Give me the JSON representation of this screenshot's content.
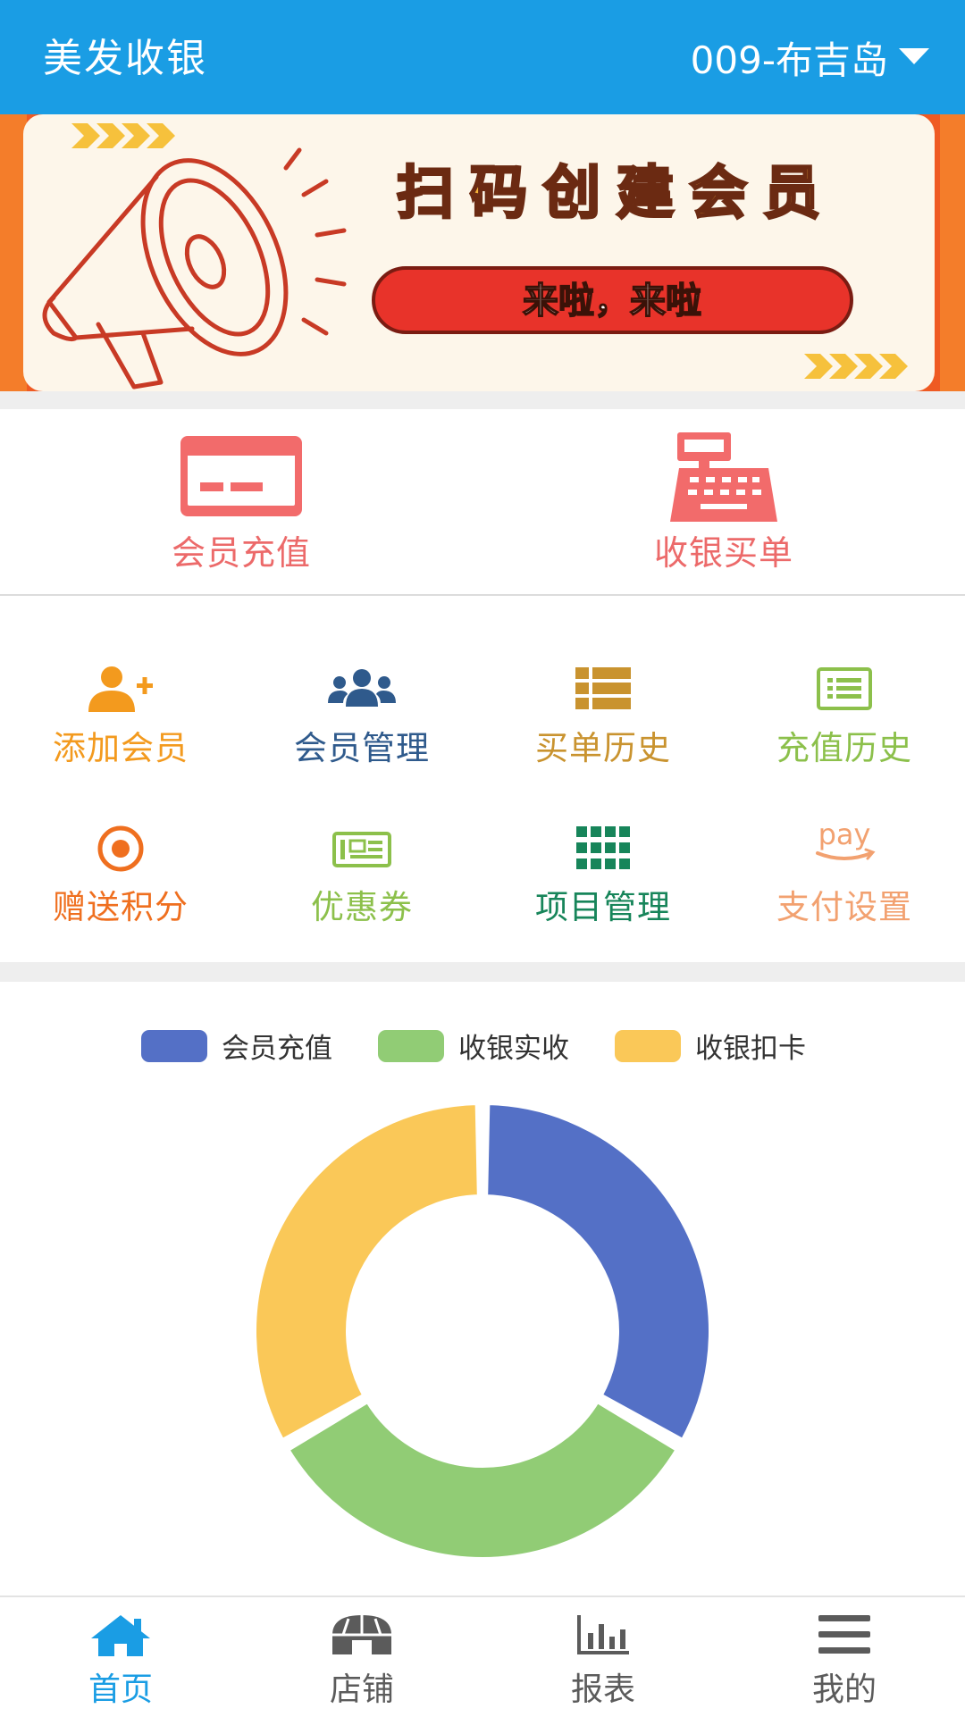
{
  "header": {
    "title": "美发收银",
    "store_name": "009-布吉岛",
    "bg_color": "#1a9de4"
  },
  "banner": {
    "headline": "扫码创建会员",
    "pill_text": "来啦，来啦"
  },
  "main_actions": [
    {
      "label": "会员充值",
      "icon": "card-icon",
      "color": "#ec6a6a"
    },
    {
      "label": "收银买单",
      "icon": "cash-register-icon",
      "color": "#ec6a6a"
    }
  ],
  "grid": [
    {
      "label": "添加会员",
      "icon": "add-user-icon",
      "color": "#f39a1e"
    },
    {
      "label": "会员管理",
      "icon": "users-icon",
      "color": "#2f5a8c"
    },
    {
      "label": "买单历史",
      "icon": "list-icon",
      "color": "#c9932f"
    },
    {
      "label": "充值历史",
      "icon": "list-box-icon",
      "color": "#8cc04b"
    },
    {
      "label": "赠送积分",
      "icon": "target-icon",
      "color": "#ef6f1f"
    },
    {
      "label": "优惠券",
      "icon": "coupon-icon",
      "color": "#8cc04b"
    },
    {
      "label": "项目管理",
      "icon": "grid-icon",
      "color": "#17855a"
    },
    {
      "label": "支付设置",
      "icon": "pay-icon",
      "color": "#f2a170"
    }
  ],
  "chart_data": {
    "type": "pie",
    "series": [
      {
        "name": "会员充值",
        "value": 1,
        "color": "#5470c6"
      },
      {
        "name": "收银实收",
        "value": 1,
        "color": "#91cc75"
      },
      {
        "name": "收银扣卡",
        "value": 1,
        "color": "#fac858"
      }
    ],
    "legend_position": "top"
  },
  "tabs": [
    {
      "label": "首页",
      "icon": "home-icon",
      "active": true
    },
    {
      "label": "店铺",
      "icon": "store-icon",
      "active": false
    },
    {
      "label": "报表",
      "icon": "chart-icon",
      "active": false
    },
    {
      "label": "我的",
      "icon": "menu-icon",
      "active": false
    }
  ],
  "colors": {
    "tab_active": "#1a9de4",
    "tab_inactive": "#5b5b5b"
  }
}
